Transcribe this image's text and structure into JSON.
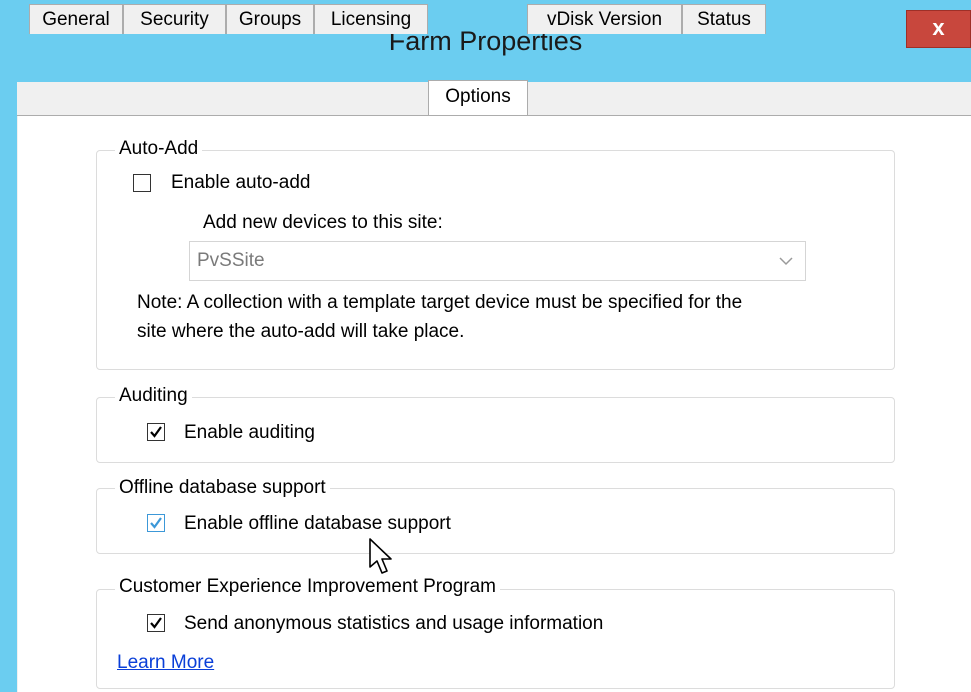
{
  "window": {
    "title": "Farm Properties",
    "close_glyph": "x"
  },
  "tabs": [
    {
      "label": "General"
    },
    {
      "label": "Security"
    },
    {
      "label": "Groups"
    },
    {
      "label": "Licensing"
    },
    {
      "label": "Options",
      "active": true
    },
    {
      "label": "vDisk Version"
    },
    {
      "label": "Status"
    }
  ],
  "auto_add": {
    "group_label": "Auto-Add",
    "enable_label": "Enable auto-add",
    "enable_checked": false,
    "site_label": "Add new devices to this site:",
    "site_value": "PvSSite",
    "note_line1": "Note: A collection with a template target device must be specified for the",
    "note_line2": "site where the auto-add will take place."
  },
  "auditing": {
    "group_label": "Auditing",
    "enable_label": "Enable auditing",
    "enable_checked": true
  },
  "offline_db": {
    "group_label": "Offline database support",
    "enable_label": "Enable offline database support",
    "enable_checked": true
  },
  "ceip": {
    "group_label": "Customer Experience Improvement Program",
    "send_label": "Send anonymous statistics and usage information",
    "send_checked": true,
    "learn_more": "Learn More"
  },
  "colors": {
    "titlebar": "#6bcdf0",
    "close": "#c8473d",
    "link": "#0a3fd8",
    "checkbox_focus": "#3c98d8"
  }
}
